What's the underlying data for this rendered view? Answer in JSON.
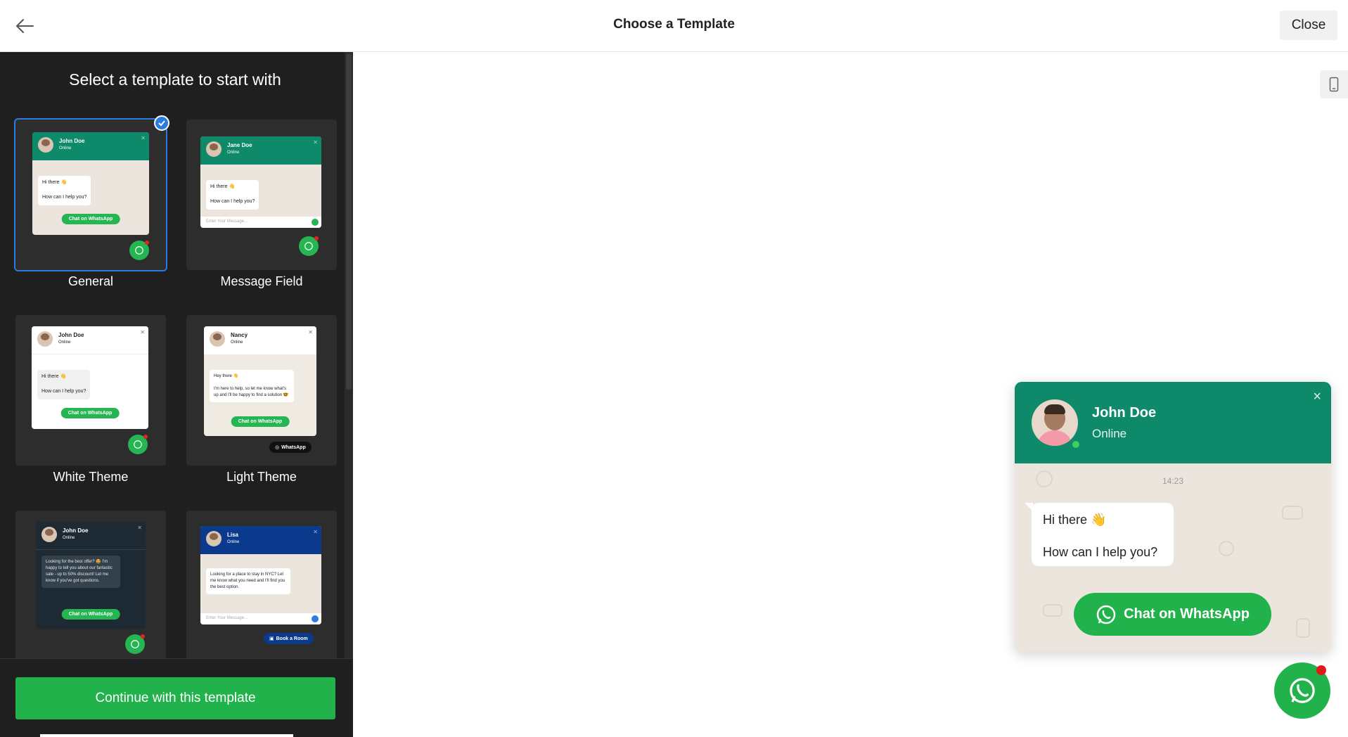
{
  "header": {
    "title": "Choose a Template",
    "close_label": "Close"
  },
  "sidebar": {
    "heading": "Select a template to start with",
    "templates": [
      {
        "label": "General",
        "selected": true,
        "agent_name": "John Doe",
        "agent_status": "Online",
        "greeting": "Hi there 👋",
        "question": "How can I help you?",
        "cta": "Chat on WhatsApp"
      },
      {
        "label": "Message Field",
        "selected": false,
        "agent_name": "Jane Doe",
        "agent_status": "Online",
        "greeting": "Hi there 👋",
        "question": "How can I help you?",
        "input_placeholder": "Enter Your Message..."
      },
      {
        "label": "White Theme",
        "selected": false,
        "agent_name": "John Doe",
        "agent_status": "Online",
        "greeting": "Hi there 👋",
        "question": "How can I help you?",
        "cta": "Chat on WhatsApp"
      },
      {
        "label": "Light Theme",
        "selected": false,
        "agent_name": "Nancy",
        "agent_status": "Online",
        "greeting": "Hey there 👋",
        "message": "I'm here to help, so let me know what's up and I'll be happy to find a solution 🤓",
        "cta": "Chat on WhatsApp",
        "pill": "WhatsApp"
      },
      {
        "label": "",
        "selected": false,
        "agent_name": "John Doe",
        "agent_status": "Online",
        "message": "Looking for the best offer? 🤩 I'm happy to tell you about our fantastic sale - up to 50% discount! Let me know if you've got questions.",
        "cta": "Chat on WhatsApp"
      },
      {
        "label": "",
        "selected": false,
        "agent_name": "Lisa",
        "agent_status": "Online",
        "message": "Looking for a place to stay in NYC? Let me know what you need and I'll find you the best option.",
        "input_placeholder": "Enter Your Message...",
        "pill": "Book a Room"
      }
    ],
    "continue_label": "Continue with this template"
  },
  "preview": {
    "agent_name": "John Doe",
    "agent_status": "Online",
    "time": "14:23",
    "greeting": "Hi there 👋",
    "question": "How can I help you?",
    "cta_label": "Chat on WhatsApp",
    "close_glyph": "×"
  },
  "colors": {
    "whatsapp_green": "#22b24c",
    "header_teal": "#0e8a6b",
    "sidebar_bg": "#1f1f1f",
    "selected_blue": "#2b7be4",
    "dark_theme": "#1e2a33",
    "blue_theme": "#0b3a8c"
  },
  "icons": [
    "back-arrow-icon",
    "mobile-device-icon",
    "whatsapp-icon",
    "check-icon",
    "close-icon"
  ]
}
